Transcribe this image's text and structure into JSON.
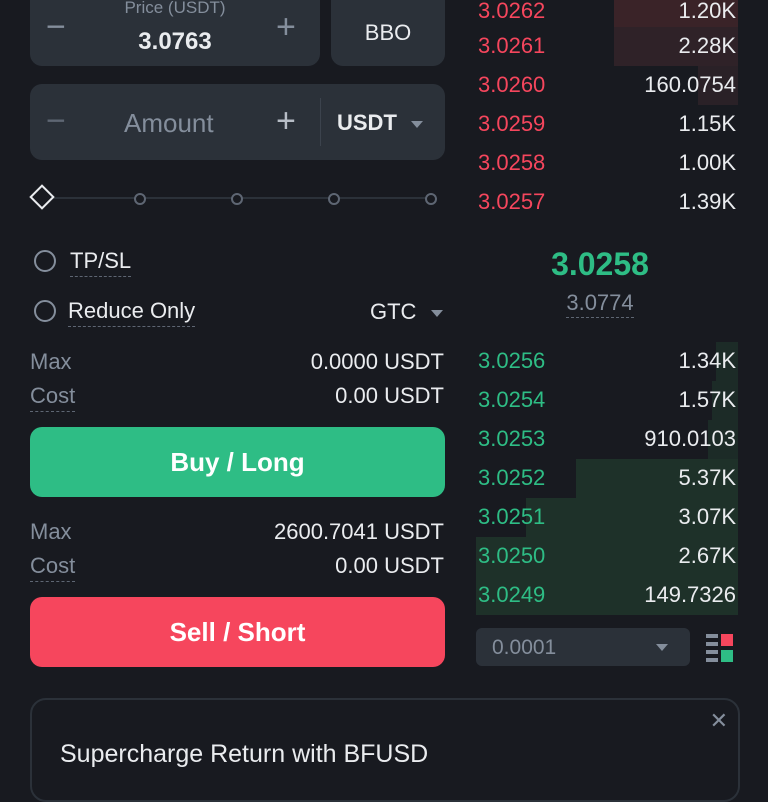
{
  "price": {
    "label": "Price (USDT)",
    "value": "3.0763",
    "minus": "−",
    "plus": "+"
  },
  "bbo_label": "BBO",
  "amount": {
    "placeholder": "Amount",
    "minus": "−",
    "plus": "+",
    "unit": "USDT"
  },
  "tpsl_label": "TP/SL",
  "reduce_only_label": "Reduce Only",
  "tif": {
    "value": "GTC"
  },
  "buy": {
    "max_label": "Max",
    "max_value": "0.0000 USDT",
    "cost_label": "Cost",
    "cost_value": "0.00 USDT",
    "button": "Buy / Long"
  },
  "sell": {
    "max_label": "Max",
    "max_value": "2600.7041 USDT",
    "cost_label": "Cost",
    "cost_value": "0.00 USDT",
    "button": "Sell / Short"
  },
  "orderbook": {
    "asks": [
      {
        "price": "3.0262",
        "qty": "1.20K"
      },
      {
        "price": "3.0261",
        "qty": "2.28K"
      },
      {
        "price": "3.0260",
        "qty": "160.0754"
      },
      {
        "price": "3.0259",
        "qty": "1.15K"
      },
      {
        "price": "3.0258",
        "qty": "1.00K"
      },
      {
        "price": "3.0257",
        "qty": "1.39K"
      }
    ],
    "last_price": "3.0258",
    "mark_price": "3.0774",
    "bids": [
      {
        "price": "3.0256",
        "qty": "1.34K"
      },
      {
        "price": "3.0254",
        "qty": "1.57K"
      },
      {
        "price": "3.0253",
        "qty": "910.0103"
      },
      {
        "price": "3.0252",
        "qty": "5.37K"
      },
      {
        "price": "3.0251",
        "qty": "3.07K"
      },
      {
        "price": "3.0250",
        "qty": "2.67K"
      },
      {
        "price": "3.0249",
        "qty": "149.7326"
      }
    ],
    "tick_size": "0.0001"
  },
  "promo": {
    "title": "Supercharge Return with BFUSD",
    "close": "✕"
  },
  "colors": {
    "ask": "#f6465d",
    "bid": "#2ebd85",
    "panel": "#2b3139",
    "bg": "#181a20"
  }
}
